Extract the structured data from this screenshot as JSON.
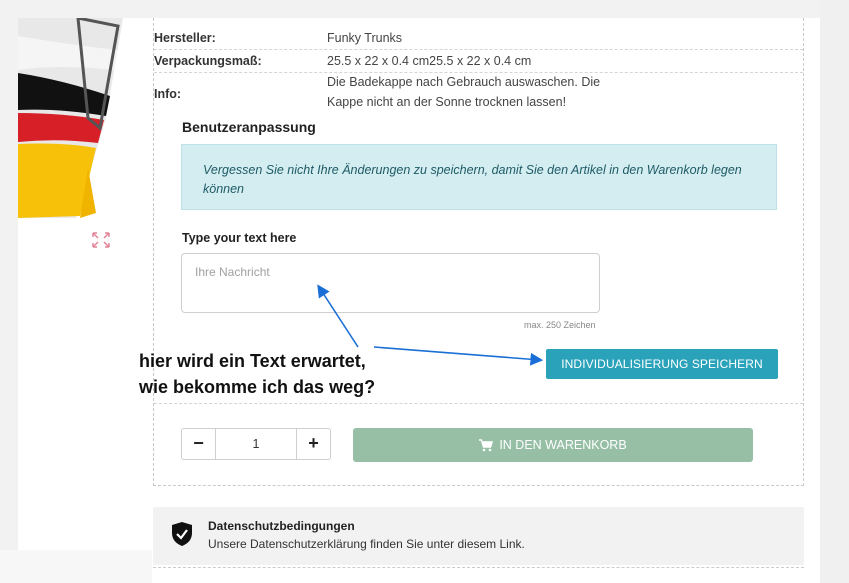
{
  "product": {
    "details": [
      {
        "label": "Hersteller:",
        "value": "Funky Trunks"
      },
      {
        "label": "Verpackungsmaß:",
        "value": "25.5 x 22 x 0.4 cm25.5 x 22 x 0.4 cm"
      },
      {
        "label": "Info:",
        "value_line1": "Die Badekappe nach Gebrauch auswaschen. Die",
        "value_line2": "Kappe nicht an der Sonne trocknen lassen!"
      }
    ]
  },
  "customization": {
    "title": "Benutzeranpassung",
    "notice_line1": "Vergessen Sie nicht Ihre Änderungen zu speichern, damit Sie den Artikel in den Warenkorb legen",
    "notice_line2": "können",
    "field_label": "Type your text here",
    "placeholder": "Ihre Nachricht",
    "max_chars": "max. 250 Zeichen",
    "save_label": "INDIVIDUALISIERUNG SPEICHERN"
  },
  "cart": {
    "quantity": "1",
    "minus": "−",
    "plus": "+",
    "add_label": "IN DEN WARENKORB",
    "icon": "cart-icon"
  },
  "privacy": {
    "title": "Datenschutzbedingungen",
    "text": "Unsere Datenschutzerklärung finden Sie unter diesem Link.",
    "icon": "shield-check-icon"
  },
  "annotation": {
    "line1": "hier wird ein Text erwartet,",
    "line2": "wie bekomme ich das weg?"
  },
  "colors": {
    "accent": "#2aa3ba",
    "cart_button": "#96bfa5",
    "notice_bg": "#d4edf1",
    "arrow": "#1a6fd6"
  }
}
